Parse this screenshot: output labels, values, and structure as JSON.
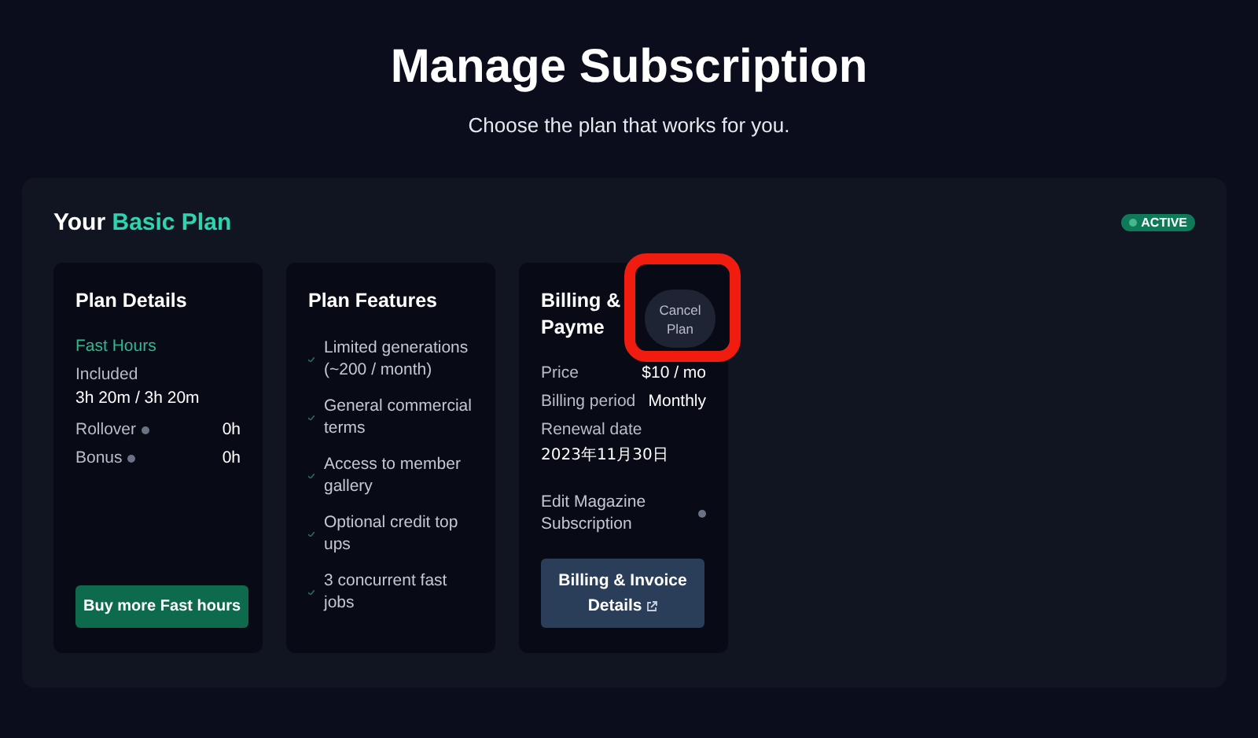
{
  "header": {
    "title": "Manage Subscription",
    "subtitle": "Choose the plan that works for you."
  },
  "plan": {
    "prefix": "Your",
    "name": "Basic Plan",
    "status": "ACTIVE"
  },
  "plan_details": {
    "title": "Plan Details",
    "section": "Fast Hours",
    "included_label": "Included",
    "included_value": "3h 20m / 3h 20m",
    "rows": [
      {
        "label": "Rollover",
        "value": "0h"
      },
      {
        "label": "Bonus",
        "value": "0h"
      }
    ],
    "button": "Buy more Fast hours"
  },
  "plan_features": {
    "title": "Plan Features",
    "items": [
      "Limited generations (~200 / month)",
      "General commercial terms",
      "Access to member gallery",
      "Optional credit top ups",
      "3 concurrent fast jobs"
    ]
  },
  "billing": {
    "title_lines": [
      "Billing &",
      "Payme"
    ],
    "cancel_button": "Cancel Plan",
    "rows": [
      {
        "label": "Price",
        "value": "$10 / mo"
      },
      {
        "label": "Billing period",
        "value": "Monthly"
      }
    ],
    "renewal_label": "Renewal date",
    "renewal_value": "2023年11月30日",
    "edit_link": "Edit Magazine Subscription",
    "invoice_button": "Billing & Invoice Details"
  },
  "annotation": {
    "kind": "highlight"
  }
}
